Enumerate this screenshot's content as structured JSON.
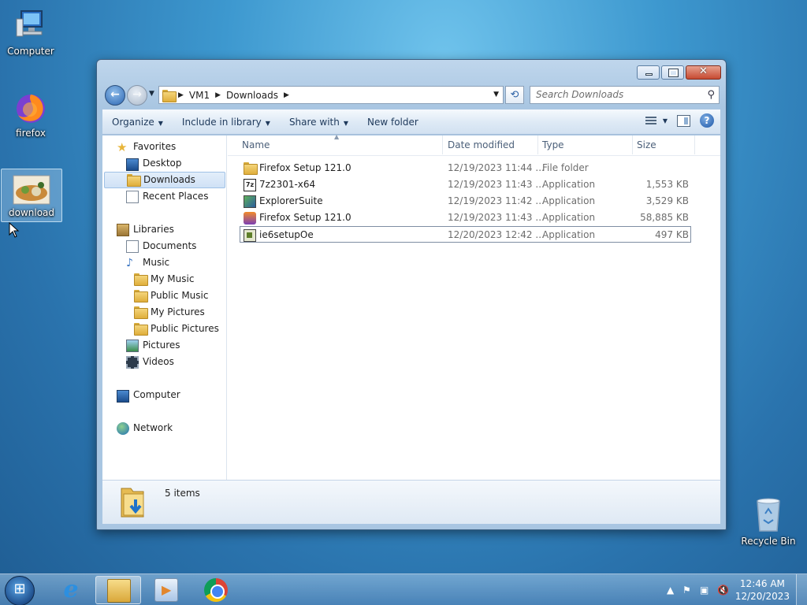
{
  "desktop": {
    "icons": [
      {
        "label": "Computer"
      },
      {
        "label": "firefox"
      },
      {
        "label": "download"
      },
      {
        "label": "Recycle Bin"
      }
    ]
  },
  "window": {
    "address": {
      "crumbs": [
        "VM1",
        "Downloads"
      ]
    },
    "search": {
      "placeholder": "Search Downloads"
    },
    "toolbar": {
      "organize": "Organize",
      "include_in_library": "Include in library",
      "share_with": "Share with",
      "new_folder": "New folder"
    },
    "nav": {
      "favorites": "Favorites",
      "desktop": "Desktop",
      "downloads": "Downloads",
      "recent_places": "Recent Places",
      "libraries": "Libraries",
      "documents": "Documents",
      "music": "Music",
      "my_music": "My Music",
      "public_music": "Public Music",
      "my_pictures": "My Pictures",
      "public_pictures": "Public Pictures",
      "pictures": "Pictures",
      "videos": "Videos",
      "computer": "Computer",
      "network": "Network"
    },
    "columns": {
      "name": "Name",
      "date_modified": "Date modified",
      "type": "Type",
      "size": "Size"
    },
    "files": [
      {
        "name": "Firefox Setup 121.0",
        "date": "12/19/2023 11:44 ...",
        "type": "File folder",
        "size": "",
        "icon": "folder-icon"
      },
      {
        "name": "7z2301-x64",
        "date": "12/19/2023 11:43 ...",
        "type": "Application",
        "size": "1,553 KB",
        "icon": "7zip-icon"
      },
      {
        "name": "ExplorerSuite",
        "date": "12/19/2023 11:42 ...",
        "type": "Application",
        "size": "3,529 KB",
        "icon": "explorersuite-icon"
      },
      {
        "name": "Firefox Setup 121.0",
        "date": "12/19/2023 11:43 ...",
        "type": "Application",
        "size": "58,885 KB",
        "icon": "firefox-installer-icon"
      },
      {
        "name": "ie6setupOe",
        "date": "12/20/2023 12:42 ...",
        "type": "Application",
        "size": "497 KB",
        "icon": "ie-setup-icon"
      }
    ],
    "details": {
      "count": "5 items"
    }
  },
  "taskbar": {
    "clock": {
      "time": "12:46 AM",
      "date": "12/20/2023"
    }
  }
}
